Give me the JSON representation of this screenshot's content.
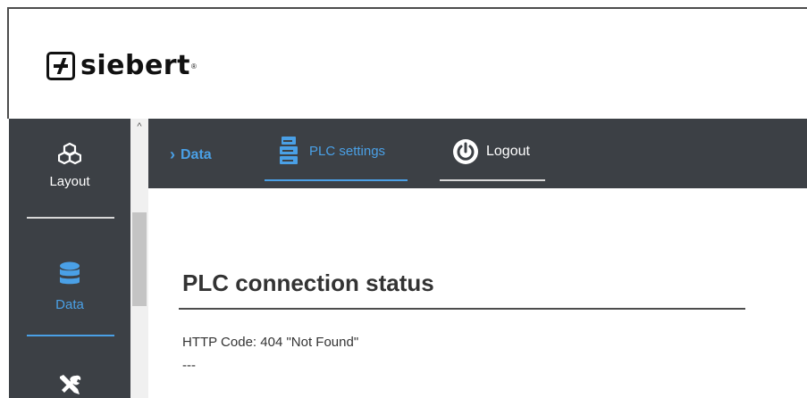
{
  "header": {
    "logo_text": "siebert",
    "logo_mark": "®"
  },
  "sidebar": {
    "items": [
      {
        "label": "Layout",
        "icon": "cubes-icon",
        "active": false
      },
      {
        "label": "Data",
        "icon": "database-icon",
        "active": true
      },
      {
        "label": "",
        "icon": "tools-icon",
        "active": false
      }
    ]
  },
  "topnav": {
    "data_label": "Data",
    "plc_label": "PLC settings",
    "logout_label": "Logout"
  },
  "main": {
    "title": "PLC connection status",
    "http_status": "HTTP Code: 404 \"Not Found\"",
    "detail": "---"
  },
  "colors": {
    "accent": "#4aa0e6",
    "dark_bg": "#3c4045",
    "text": "#333333"
  }
}
